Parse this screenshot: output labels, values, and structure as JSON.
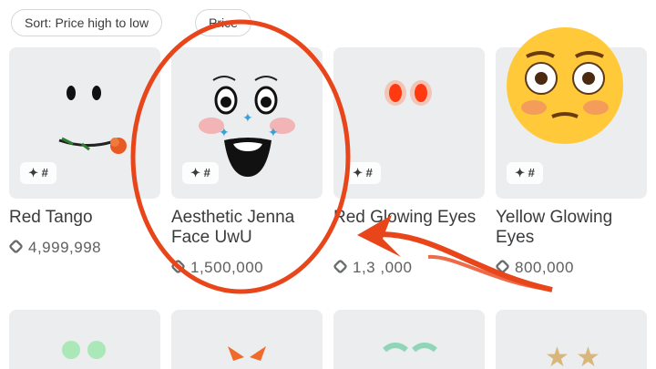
{
  "filters": {
    "sort_label": "Sort: Price high to low",
    "price_label": "Price"
  },
  "items": [
    {
      "name": "Red Tango",
      "price": "4,999,998",
      "badge": "✦ #"
    },
    {
      "name": "Aesthetic Jenna Face UwU",
      "price": "1,500,000",
      "badge": "✦ #"
    },
    {
      "name": "Red Glowing Eyes",
      "price": "1,3 ,000",
      "badge": "✦ #"
    },
    {
      "name": "Yellow Glowing Eyes",
      "price": "800,000",
      "badge": "✦ #"
    }
  ],
  "overlay": {
    "emoji": "flushed-face-emoji",
    "accent_color": "#e8461a"
  },
  "colors": {
    "thumb_bg": "#ebedef",
    "text": "#393b3d",
    "price_text": "#5f6062",
    "annotation": "#e8461a"
  }
}
